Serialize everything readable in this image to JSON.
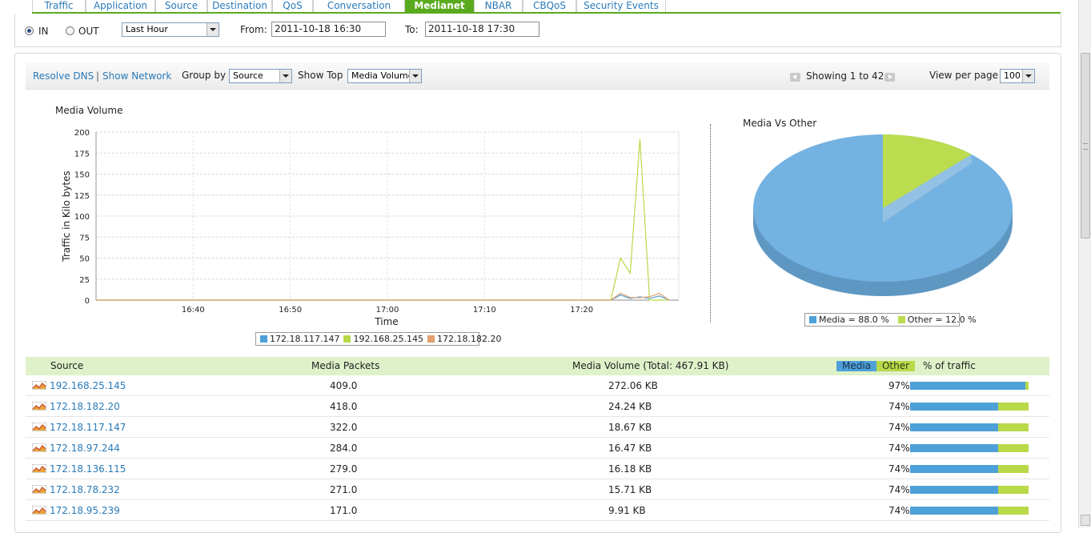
{
  "tabs": [
    {
      "label": "Traffic",
      "active": false
    },
    {
      "label": "Application",
      "active": false
    },
    {
      "label": "Source",
      "active": false
    },
    {
      "label": "Destination",
      "active": false
    },
    {
      "label": "QoS",
      "active": false
    },
    {
      "label": "Conversation",
      "active": false
    },
    {
      "label": "Medianet",
      "active": true
    },
    {
      "label": "NBAR",
      "active": false
    },
    {
      "label": "CBQoS",
      "active": false
    },
    {
      "label": "Security Events",
      "active": false
    }
  ],
  "filter": {
    "in_label": "IN",
    "out_label": "OUT",
    "direction_selected": "IN",
    "period": "Last Hour",
    "from_label": "From:",
    "from_value": "2011-10-18 16:30",
    "to_label": "To:",
    "to_value": "2011-10-18 17:30"
  },
  "toolbar": {
    "resolve_dns": "Resolve DNS",
    "separator": "|",
    "show_network": "Show Network",
    "group_by_label": "Group by",
    "group_by_value": "Source",
    "show_top_label": "Show Top",
    "show_top_value": "Media Volume",
    "showing": "Showing 1 to 42",
    "view_per_page_label": "View per page",
    "view_per_page_value": "100"
  },
  "colors": {
    "tab_active": "#5aaa1e",
    "link": "#2a7ab8",
    "series_blue": "#4da0d8",
    "series_green": "#b9d949",
    "series_orange": "#e0a070",
    "pie_media": "#74b2e2",
    "pie_other": "#bcdc4f",
    "header_bg": "#dff1c9"
  },
  "chart_data": [
    {
      "type": "line",
      "title": "Media Volume",
      "xlabel": "Time",
      "ylabel": "Traffic in Kilo bytes",
      "ylim": [
        0,
        200
      ],
      "y_ticks": [
        "0",
        "25",
        "50",
        "75",
        "100",
        "125",
        "150",
        "175",
        "200"
      ],
      "x_ticks": [
        "16:40",
        "16:50",
        "17:00",
        "17:10",
        "17:20"
      ],
      "grid": true,
      "legend_position": "bottom",
      "x": [
        "16:30",
        "17:22",
        "17:23",
        "17:24",
        "17:25",
        "17:26",
        "17:27",
        "17:28",
        "17:29"
      ],
      "series": [
        {
          "name": "172.18.117.147",
          "color": "#4da0d8",
          "values": [
            0,
            0,
            0,
            6,
            2,
            4,
            2,
            5,
            0
          ]
        },
        {
          "name": "192.168.25.145",
          "color": "#b9d949",
          "values": [
            0,
            0,
            0,
            50,
            32,
            192,
            0,
            0,
            0
          ]
        },
        {
          "name": "172.18.182.20",
          "color": "#e0a070",
          "values": [
            0,
            0,
            0,
            8,
            3,
            3,
            4,
            8,
            0
          ]
        }
      ]
    },
    {
      "type": "pie",
      "title": "Media Vs Other",
      "legend_position": "bottom",
      "slices": [
        {
          "label": "Media",
          "value": 88.0,
          "legend": "Media = 88.0 %",
          "color": "#74b2e2"
        },
        {
          "label": "Other",
          "value": 12.0,
          "legend": "Other = 12.0 %",
          "color": "#bcdc4f"
        }
      ]
    }
  ],
  "table": {
    "headers": {
      "source": "Source",
      "packets": "Media Packets",
      "volume": "Media Volume (Total: 467.91 KB)",
      "media": "Media",
      "other": "Other",
      "pct": "% of traffic"
    },
    "rows": [
      {
        "source": "192.168.25.145",
        "packets": "409.0",
        "volume": "272.06 KB",
        "pct": "97%",
        "media_frac": 0.97
      },
      {
        "source": "172.18.182.20",
        "packets": "418.0",
        "volume": "24.24 KB",
        "pct": "74%",
        "media_frac": 0.74
      },
      {
        "source": "172.18.117.147",
        "packets": "322.0",
        "volume": "18.67 KB",
        "pct": "74%",
        "media_frac": 0.74
      },
      {
        "source": "172.18.97.244",
        "packets": "284.0",
        "volume": "16.47 KB",
        "pct": "74%",
        "media_frac": 0.74
      },
      {
        "source": "172.18.136.115",
        "packets": "279.0",
        "volume": "16.18 KB",
        "pct": "74%",
        "media_frac": 0.74
      },
      {
        "source": "172.18.78.232",
        "packets": "271.0",
        "volume": "15.71 KB",
        "pct": "74%",
        "media_frac": 0.74
      },
      {
        "source": "172.18.95.239",
        "packets": "171.0",
        "volume": "9.91 KB",
        "pct": "74%",
        "media_frac": 0.74
      }
    ]
  }
}
